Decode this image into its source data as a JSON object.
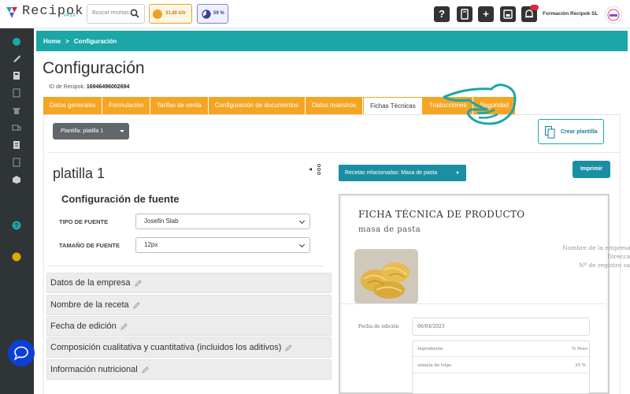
{
  "app": {
    "logo_text": "Recipok",
    "version": "V4.19",
    "search_placeholder": "Buscar recetas...",
    "credit_value": "31,60 €/tr",
    "usage_value": "59 %",
    "help_symbol": "?",
    "add_symbol": "+",
    "company_name": "Formación Recipok SL",
    "colors": {
      "brand_teal": "#1ba6a8",
      "tab_orange": "#f5a523",
      "sidebar": "#2f3437",
      "button_teal": "#1a8fa4"
    }
  },
  "sidebar": {
    "icons": [
      "dashboard-icon",
      "knife-icon",
      "book-icon",
      "document-icon",
      "chef-icon",
      "truck-icon",
      "list-icon",
      "calculator-icon",
      "cube-icon",
      "help-icon",
      "coin-icon"
    ]
  },
  "breadcrumb": {
    "home": "Home",
    "separator": ">",
    "current": "Configuración"
  },
  "page": {
    "title": "Configuración",
    "id_label": "ID de Recipok:",
    "id_value": "16946496002694"
  },
  "tabs": [
    {
      "label": "Datos generales",
      "active": false
    },
    {
      "label": "Formulación",
      "active": false
    },
    {
      "label": "Tarifas de venta",
      "active": false
    },
    {
      "label": "Configuración de documentos",
      "active": false
    },
    {
      "label": "Datos maestros",
      "active": false
    },
    {
      "label": "Fichas Técnicas",
      "active": true
    },
    {
      "label": "Traducciones",
      "active": false
    },
    {
      "label": "Seguridad",
      "active": false
    }
  ],
  "template_select": {
    "label": "Plantilla: platilla 1"
  },
  "create_button": {
    "label": "Crear plantilla"
  },
  "editor": {
    "template_name": "platilla 1",
    "font_section_title": "Configuración de fuente",
    "font_type_label": "TIPO DE FUENTE",
    "font_type_value": "Josefin Slab",
    "font_size_label": "TAMAÑO DE FUENTE",
    "font_size_value": "12px",
    "sections": [
      "Datos de la empresa",
      "Nombre de la receta",
      "Fecha de edición",
      "Composición cualitativa y cuantitativa (incluidos los aditivos)",
      "Información nutricional"
    ]
  },
  "preview": {
    "related_button": "Recetas relacionadas: Masa de pasta",
    "print_button": "Imprimir",
    "sheet_title": "FICHA TÉCNICA DE PRODUCTO",
    "recipe_name": "masa de pasta",
    "company_lines": [
      "Nombre de la empresa:",
      "Dirección",
      "Nº de registro sanitario"
    ],
    "edition_label": "Fecha de edición",
    "edition_value": "06/04/2023",
    "table_headers": {
      "ingredient": "Ingrediente",
      "percent": "% Peso"
    },
    "table_rows": [
      {
        "ingredient": "sémola de trigo",
        "percent": "35 %"
      }
    ]
  }
}
